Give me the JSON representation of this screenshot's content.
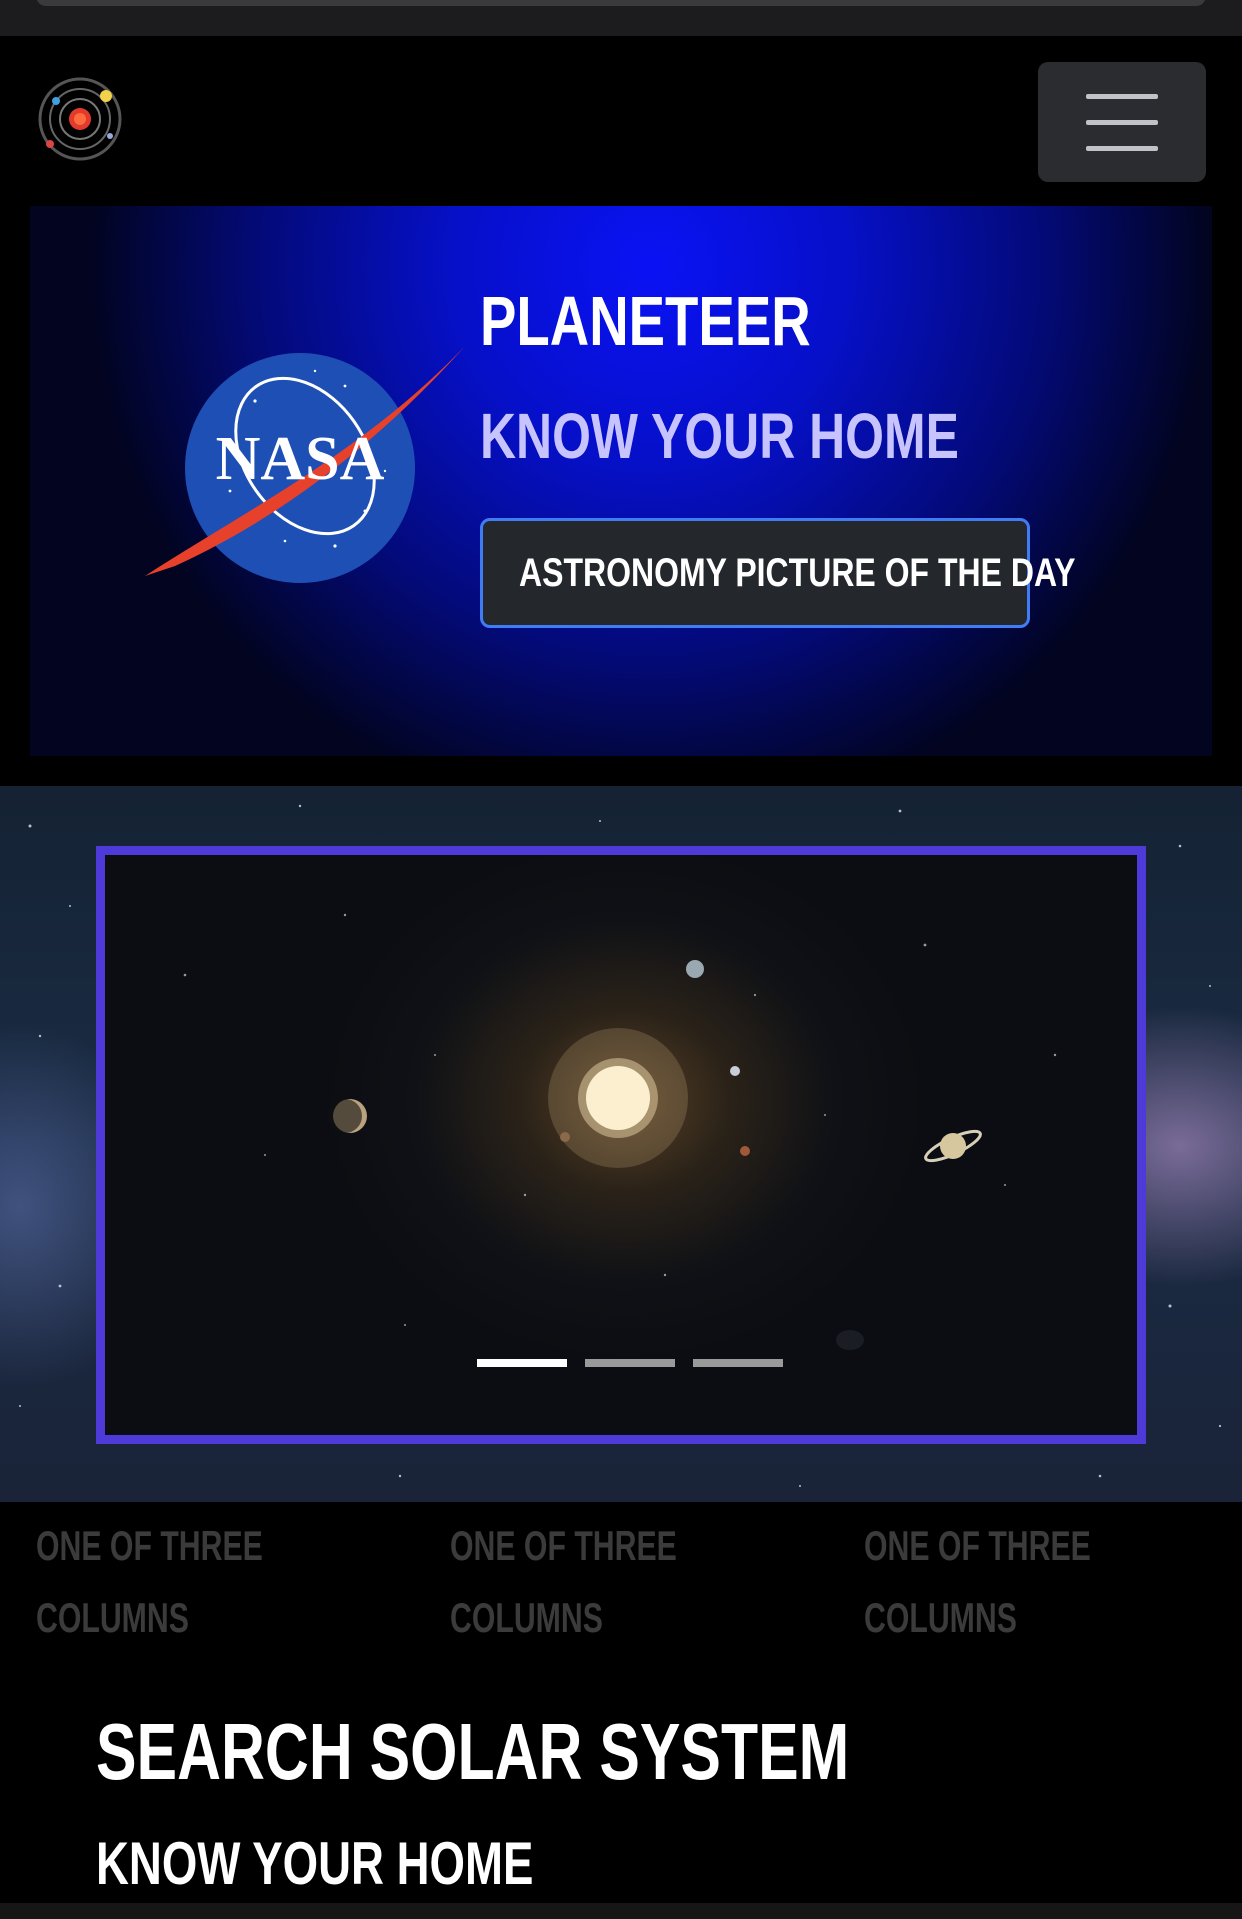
{
  "hero": {
    "title": "PLANETEER",
    "subtitle": "KNOW YOUR HOME",
    "button_label": "ASTRONOMY PICTURE OF THE DAY"
  },
  "nasa_logo_text": "NASA",
  "carousel": {
    "slide_count": 3,
    "active_index": 0
  },
  "columns": [
    {
      "line1": "ONE OF THREE",
      "line2": "COLUMNS"
    },
    {
      "line1": "ONE OF THREE",
      "line2": "COLUMNS"
    },
    {
      "line1": "ONE OF THREE",
      "line2": "COLUMNS"
    }
  ],
  "search": {
    "title": "SEARCH SOLAR SYSTEM",
    "subtitle": "KNOW YOUR HOME"
  },
  "colors": {
    "hero_blue": "#0a12f5",
    "button_border": "#3f7cf5",
    "carousel_border": "#4d3ad8"
  },
  "icons": [
    "solar-system-logo-icon",
    "menu-hamburger-icon",
    "nasa-logo"
  ]
}
